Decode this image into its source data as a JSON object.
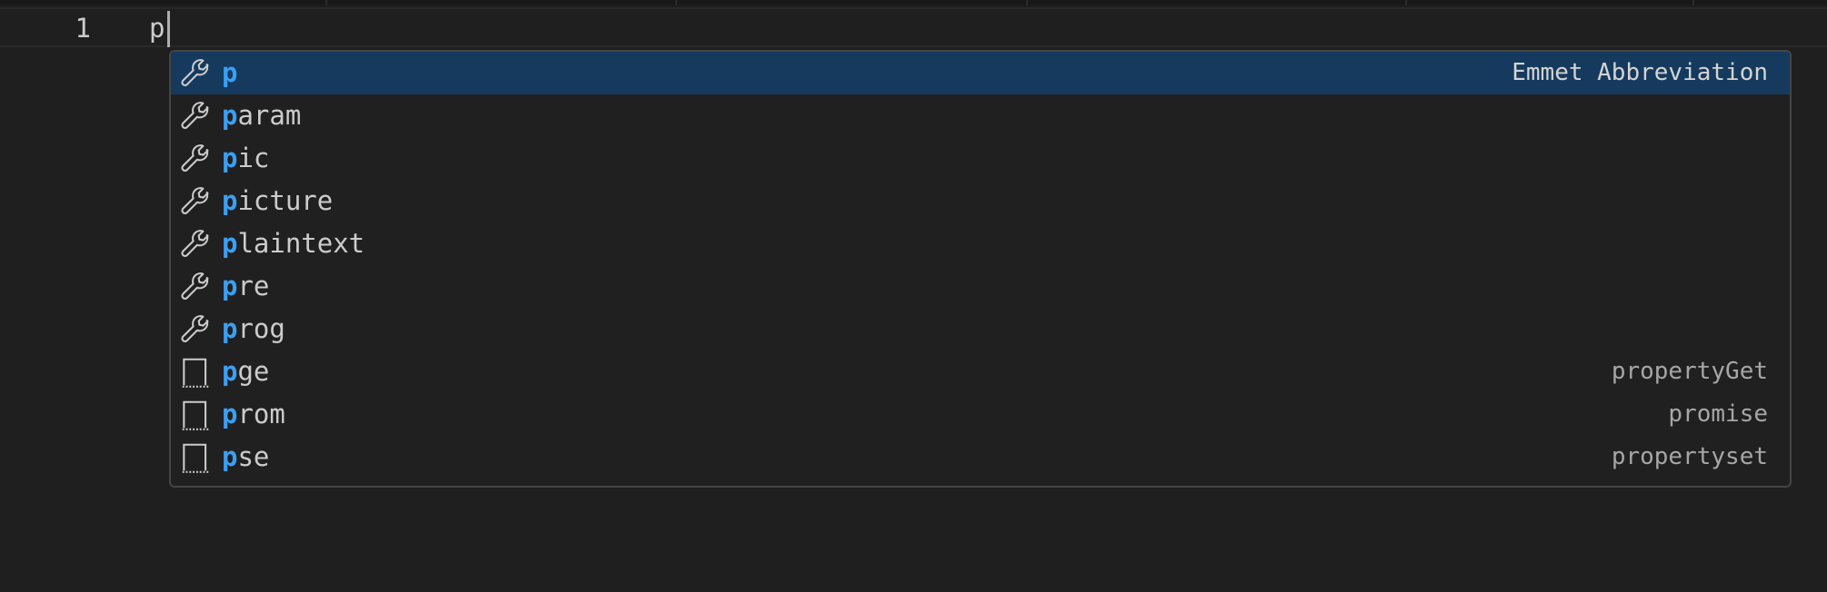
{
  "editor": {
    "line_number": "1",
    "line_text": "p"
  },
  "suggestions": {
    "query": "p",
    "items": [
      {
        "match": "p",
        "rest": "",
        "detail": "Emmet Abbreviation",
        "icon": "wrench-icon",
        "selected": true
      },
      {
        "match": "p",
        "rest": "aram",
        "detail": "",
        "icon": "wrench-icon",
        "selected": false
      },
      {
        "match": "p",
        "rest": "ic",
        "detail": "",
        "icon": "wrench-icon",
        "selected": false
      },
      {
        "match": "p",
        "rest": "icture",
        "detail": "",
        "icon": "wrench-icon",
        "selected": false
      },
      {
        "match": "p",
        "rest": "laintext",
        "detail": "",
        "icon": "wrench-icon",
        "selected": false
      },
      {
        "match": "p",
        "rest": "re",
        "detail": "",
        "icon": "wrench-icon",
        "selected": false
      },
      {
        "match": "p",
        "rest": "rog",
        "detail": "",
        "icon": "wrench-icon",
        "selected": false
      },
      {
        "match": "p",
        "rest": "ge",
        "detail": "propertyGet",
        "icon": "snippet-icon",
        "selected": false
      },
      {
        "match": "p",
        "rest": "rom",
        "detail": "promise",
        "icon": "snippet-icon",
        "selected": false
      },
      {
        "match": "p",
        "rest": "se",
        "detail": "propertyset",
        "icon": "snippet-icon",
        "selected": false
      }
    ]
  },
  "colors": {
    "editor_background": "#1f1f1f",
    "selection_background": "#153a5e",
    "match_highlight": "#3b9ff3",
    "widget_border": "#454545"
  }
}
